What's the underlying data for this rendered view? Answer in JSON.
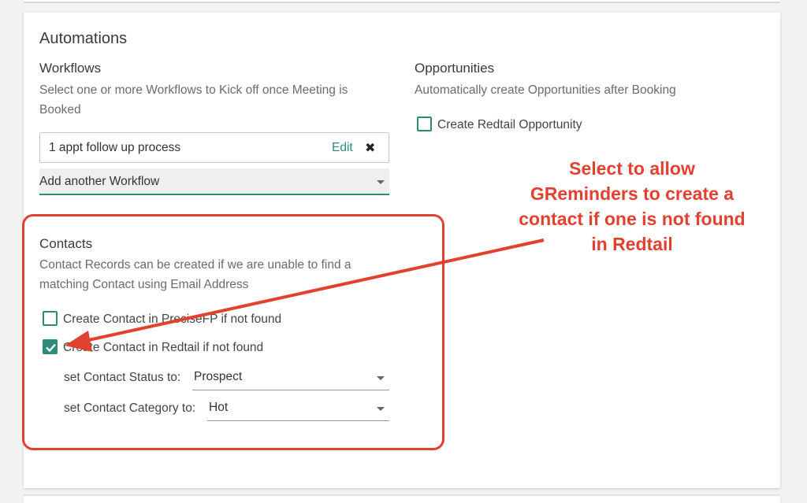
{
  "automations": {
    "title": "Automations",
    "workflows": {
      "heading": "Workflows",
      "description_line1": "Select one or more Workflows to Kick off once Meeting is",
      "description_line2": "Booked",
      "selected": {
        "name": "1 appt follow up process",
        "edit_label": "Edit",
        "remove_icon": "close-icon"
      },
      "add_select_label": "Add another Workflow"
    },
    "opportunities": {
      "heading": "Opportunities",
      "description": "Automatically create Opportunities after Booking",
      "checkbox_label": "Create Redtail Opportunity",
      "checked": false
    },
    "contacts": {
      "heading": "Contacts",
      "description_line1": "Contact Records can be created if we are unable to find a",
      "description_line2": "matching Contact using Email Address",
      "precisefp": {
        "label": "Create Contact in PreciseFP if not found",
        "checked": false
      },
      "redtail": {
        "label": "Create Contact in Redtail if not found",
        "checked": true
      },
      "status": {
        "label": "set Contact Status to:",
        "value": "Prospect"
      },
      "category": {
        "label": "set Contact Category to:",
        "value": "Hot"
      }
    }
  },
  "annotation": {
    "line1": "Select to allow",
    "line2": "GReminders to create a",
    "line3": "contact if one is not found",
    "line4": "in Redtail",
    "color": "#e1412f"
  },
  "colors": {
    "accent": "#2e8b7a",
    "annotation": "#e1412f"
  }
}
